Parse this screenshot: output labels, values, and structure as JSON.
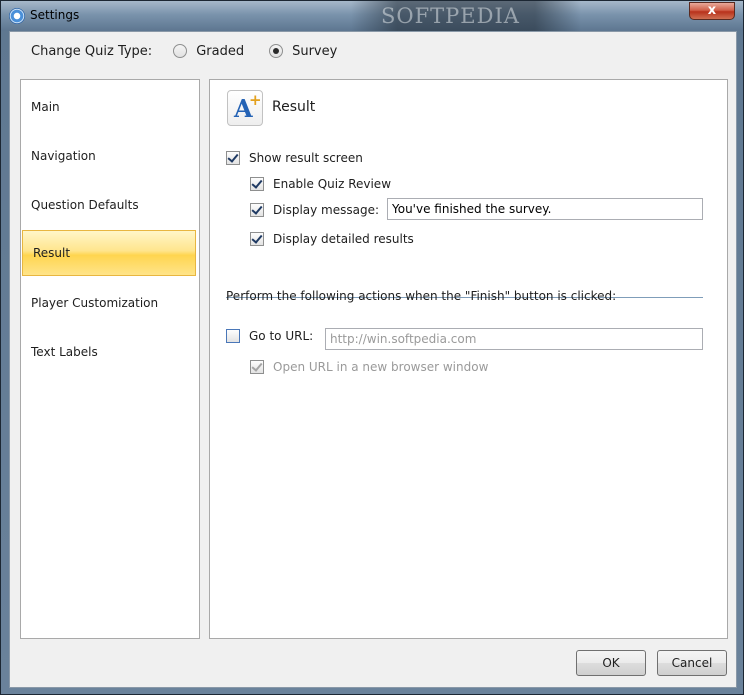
{
  "window": {
    "title": "Settings",
    "banner": "SOFTPEDIA",
    "close_glyph": "x"
  },
  "quiz_type": {
    "label": "Change Quiz Type:",
    "options": [
      {
        "label": "Graded",
        "selected": false
      },
      {
        "label": "Survey",
        "selected": true
      }
    ]
  },
  "sidebar": {
    "items": [
      {
        "label": "Main"
      },
      {
        "label": "Navigation"
      },
      {
        "label": "Question Defaults"
      },
      {
        "label": "Result",
        "selected": true
      },
      {
        "label": "Player Customization"
      },
      {
        "label": "Text Labels"
      }
    ]
  },
  "content": {
    "title": "Result",
    "icon": "result-a-plus-icon",
    "show_result_screen": {
      "label": "Show result screen",
      "checked": true
    },
    "enable_quiz_review": {
      "label": "Enable Quiz Review",
      "checked": true
    },
    "display_message": {
      "label": "Display message:",
      "checked": true,
      "value": "You've finished the survey."
    },
    "display_detailed_results": {
      "label": "Display detailed results",
      "checked": true
    },
    "finish_caption": "Perform the following actions when the \"Finish\" button is clicked:",
    "go_to_url": {
      "label": "Go to URL:",
      "checked": false,
      "placeholder": "http://win.softpedia.com"
    },
    "open_new_window": {
      "label": "Open URL in a new browser window",
      "checked": true,
      "disabled": true
    }
  },
  "buttons": {
    "ok": "OK",
    "cancel": "Cancel"
  },
  "colors": {
    "selected_item": "#ffe58d",
    "selected_border": "#e8b640",
    "accent_blue": "#2563b5"
  }
}
